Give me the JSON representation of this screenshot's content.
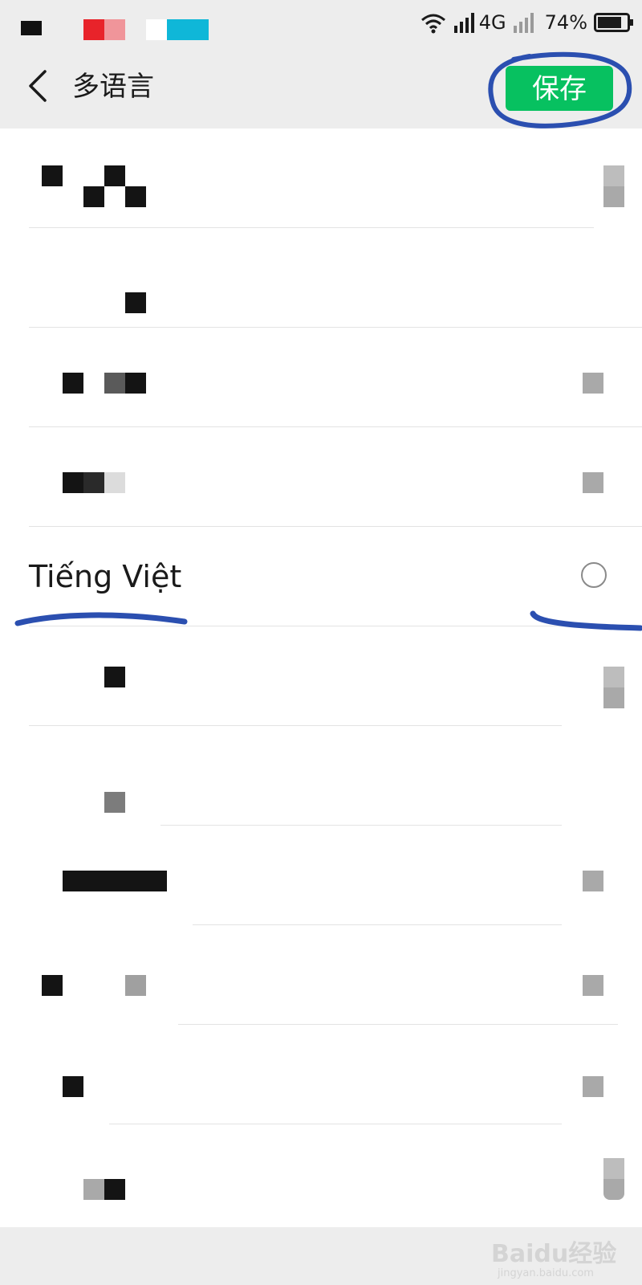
{
  "status_bar": {
    "network": "4G",
    "battery": "74%",
    "icons": [
      "wifi-icon",
      "signal-icon",
      "signal-weak-icon",
      "battery-icon"
    ]
  },
  "nav": {
    "title": "多语言",
    "save_label": "保存",
    "back_icon": "chevron-left-icon"
  },
  "list": {
    "items": [
      {
        "label": "",
        "obscured": true
      },
      {
        "label": "",
        "obscured": true
      },
      {
        "label": "",
        "obscured": true
      },
      {
        "label": "",
        "obscured": true
      },
      {
        "label": "Tiếng Việt",
        "obscured": false,
        "selected": false
      },
      {
        "label": "",
        "obscured": true
      },
      {
        "label": "",
        "obscured": true
      },
      {
        "label": "",
        "obscured": true
      },
      {
        "label": "",
        "obscured": true
      },
      {
        "label": "",
        "obscured": true
      },
      {
        "label": "",
        "obscured": true
      }
    ]
  },
  "watermark": {
    "text": "Baidu经验",
    "sub": "jingyan.baidu.com"
  },
  "colors": {
    "accent": "#07c160",
    "annotation": "#2b4fb0",
    "background": "#ededed"
  }
}
